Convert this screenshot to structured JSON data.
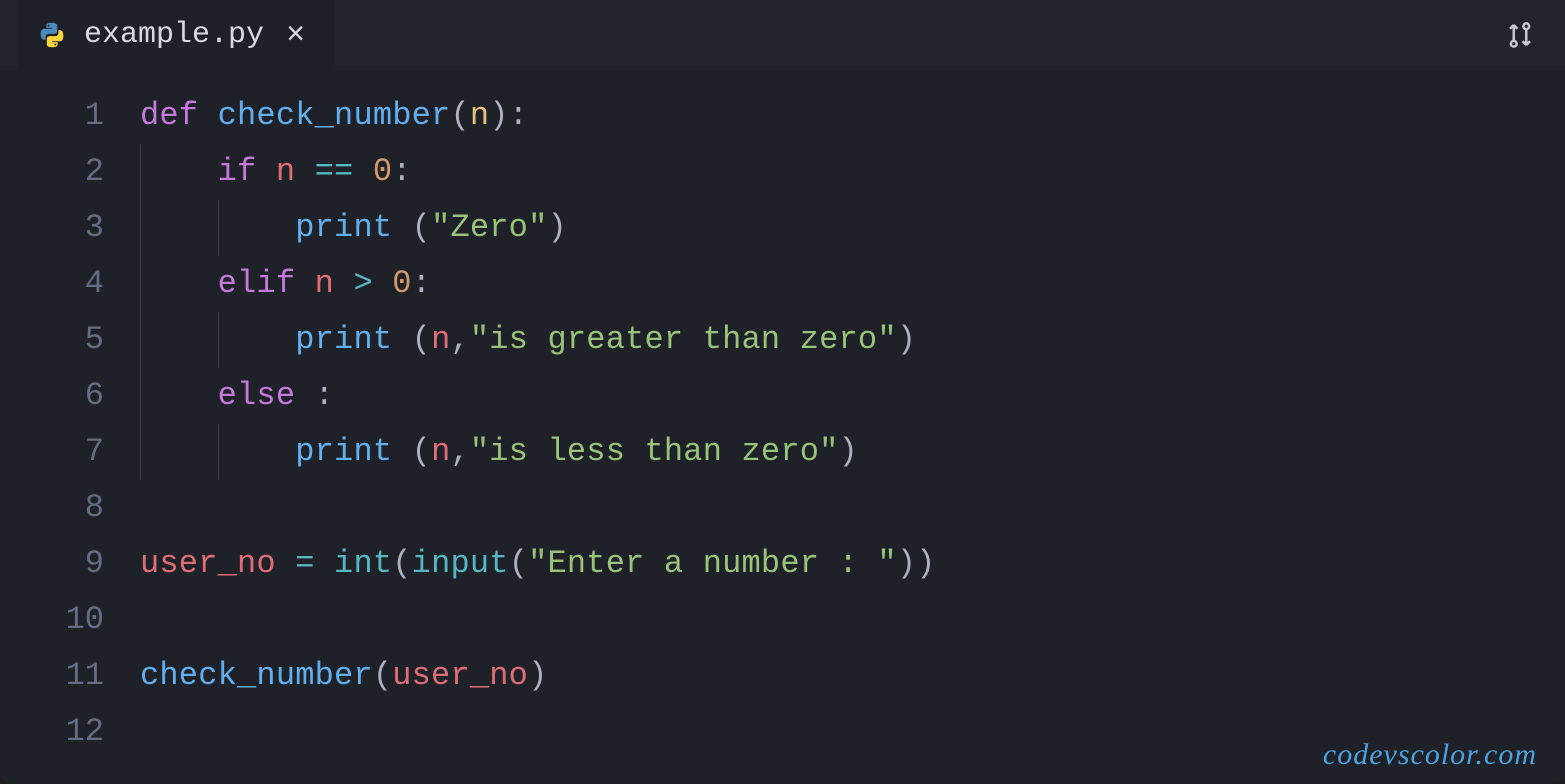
{
  "tab": {
    "filename": "example.py",
    "close_symbol": "×"
  },
  "gutter": {
    "lines": [
      "1",
      "2",
      "3",
      "4",
      "5",
      "6",
      "7",
      "8",
      "9",
      "10",
      "11",
      "12"
    ]
  },
  "code": {
    "line1": {
      "def": "def",
      "fn": "check_number",
      "paren_o": "(",
      "arg": "n",
      "paren_c": ")",
      "colon": ":"
    },
    "line2": {
      "indent": "    ",
      "if": "if",
      "sp": " ",
      "var": "n",
      "sp2": " ",
      "op": "==",
      "sp3": " ",
      "num": "0",
      "colon": ":"
    },
    "line3": {
      "indent": "        ",
      "fn": "print",
      "sp": " ",
      "paren_o": "(",
      "str": "\"Zero\"",
      "paren_c": ")"
    },
    "line4": {
      "indent": "    ",
      "elif": "elif",
      "sp": " ",
      "var": "n",
      "sp2": " ",
      "op": ">",
      "sp3": " ",
      "num": "0",
      "colon": ":"
    },
    "line5": {
      "indent": "        ",
      "fn": "print",
      "sp": " ",
      "paren_o": "(",
      "var": "n",
      "comma": ",",
      "str": "\"is greater than zero\"",
      "paren_c": ")"
    },
    "line6": {
      "indent": "    ",
      "else": "else",
      "sp": " ",
      "colon": ":"
    },
    "line7": {
      "indent": "        ",
      "fn": "print",
      "sp": " ",
      "paren_o": "(",
      "var": "n",
      "comma": ",",
      "str": "\"is less than zero\"",
      "paren_c": ")"
    },
    "line9": {
      "var": "user_no",
      "sp": " ",
      "eq": "=",
      "sp2": " ",
      "int": "int",
      "paren_o": "(",
      "input": "input",
      "paren_o2": "(",
      "str": "\"Enter a number : \"",
      "paren_c2": ")",
      "paren_c": ")"
    },
    "line11": {
      "fn": "check_number",
      "paren_o": "(",
      "var": "user_no",
      "paren_c": ")"
    }
  },
  "watermark": "codevscolor.com"
}
